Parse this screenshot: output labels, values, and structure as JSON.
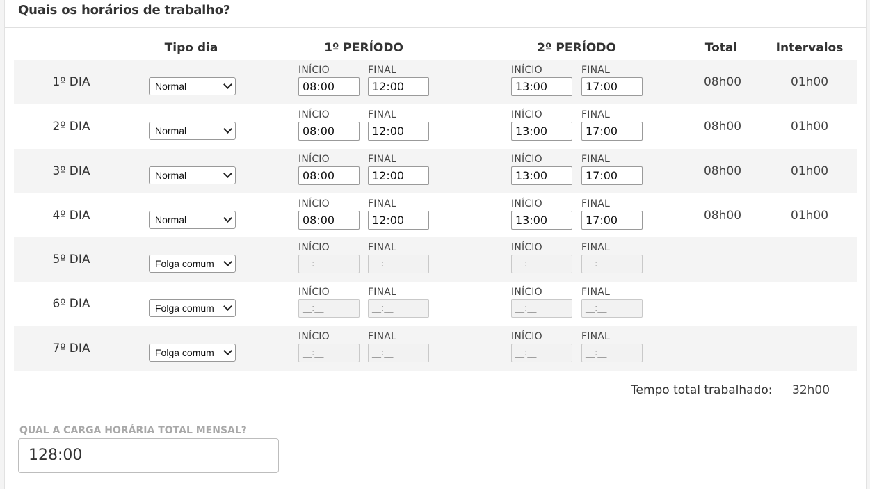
{
  "title": "Quais os horários de trabalho?",
  "headers": {
    "tipo_dia": "Tipo dia",
    "periodo1": "1º PERÍODO",
    "periodo2": "2º PERÍODO",
    "total": "Total",
    "intervalos": "Intervalos"
  },
  "field_labels": {
    "inicio": "INÍCIO",
    "final": "FINAL"
  },
  "empty_time": "__:__",
  "days": [
    {
      "label": "1º DIA",
      "tipo": "Normal",
      "p1_inicio": "08:00",
      "p1_final": "12:00",
      "p2_inicio": "13:00",
      "p2_final": "17:00",
      "total": "08h00",
      "intervalos": "01h00"
    },
    {
      "label": "2º DIA",
      "tipo": "Normal",
      "p1_inicio": "08:00",
      "p1_final": "12:00",
      "p2_inicio": "13:00",
      "p2_final": "17:00",
      "total": "08h00",
      "intervalos": "01h00"
    },
    {
      "label": "3º DIA",
      "tipo": "Normal",
      "p1_inicio": "08:00",
      "p1_final": "12:00",
      "p2_inicio": "13:00",
      "p2_final": "17:00",
      "total": "08h00",
      "intervalos": "01h00"
    },
    {
      "label": "4º DIA",
      "tipo": "Normal",
      "p1_inicio": "08:00",
      "p1_final": "12:00",
      "p2_inicio": "13:00",
      "p2_final": "17:00",
      "total": "08h00",
      "intervalos": "01h00"
    },
    {
      "label": "5º DIA",
      "tipo": "Folga comum",
      "p1_inicio": "",
      "p1_final": "",
      "p2_inicio": "",
      "p2_final": "",
      "total": "",
      "intervalos": ""
    },
    {
      "label": "6º DIA",
      "tipo": "Folga comum",
      "p1_inicio": "",
      "p1_final": "",
      "p2_inicio": "",
      "p2_final": "",
      "total": "",
      "intervalos": ""
    },
    {
      "label": "7º DIA",
      "tipo": "Folga comum",
      "p1_inicio": "",
      "p1_final": "",
      "p2_inicio": "",
      "p2_final": "",
      "total": "",
      "intervalos": ""
    }
  ],
  "tempo_total": {
    "label": "Tempo total trabalhado:",
    "value": "32h00"
  },
  "carga": {
    "label": "QUAL A CARGA HORÁRIA TOTAL MENSAL?",
    "value": "128:00"
  }
}
